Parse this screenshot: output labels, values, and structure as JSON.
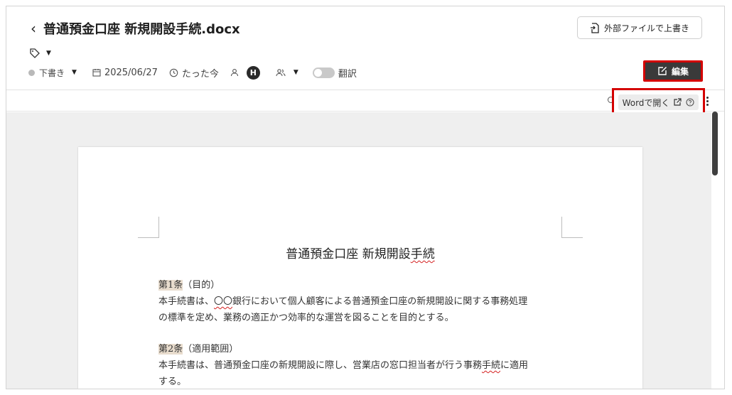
{
  "header": {
    "title": "普通預金口座 新規開設手続.docx",
    "overwrite_label": "外部ファイルで上書き",
    "edit_label": "編集"
  },
  "meta": {
    "status": "下書き",
    "date": "2025/06/27",
    "updated": "たった今",
    "avatar_initial": "H",
    "translate_label": "翻訳"
  },
  "viewer": {
    "open_in_word_label": "Wordで開く"
  },
  "document": {
    "heading_main": "普通預金口座 新規開設",
    "heading_squiggle": "手続",
    "article1_head": "第1条",
    "article1_title": "（目的）",
    "article1_line1_a": "本手続書は、",
    "article1_line1_squiggle": "〇〇",
    "article1_line1_b": "銀行において個人顧客による普通預金口座の新規開設に関する事務処理",
    "article1_line2": "の標準を定め、業務の適正かつ効率的な運営を図ることを目的とする。",
    "article2_head": "第2条",
    "article2_title": "（適用範囲）",
    "article2_line1_a": "本手続書は、普通預金口座の新規開設に際し、営業店の窓口担当者が行う事務",
    "article2_line1_squiggle": "手続",
    "article2_line1_b": "に適用",
    "article2_line2": "する。"
  },
  "colors": {
    "highlight_frame": "#d40000",
    "edit_button_bg": "#3a3a3a",
    "article_highlight": "#e8dccd"
  }
}
